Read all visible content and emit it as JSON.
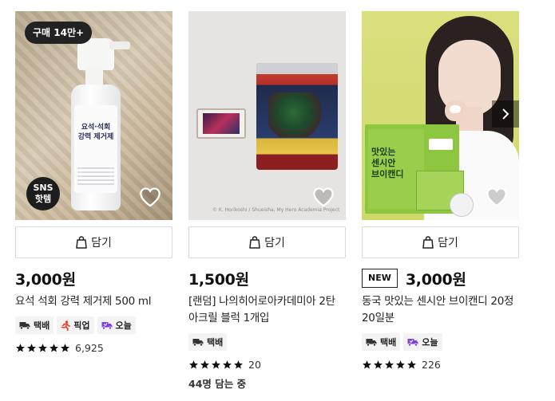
{
  "products": [
    {
      "image_badge": "구매 14만+",
      "sns_badge": "SNS\n핫템",
      "label_text": "요석·석회\n강력 제거제",
      "cart_label": "담기",
      "new_badge": "",
      "price": "3,000원",
      "name": "요석 석회 강력 제거제 500 ml",
      "tags": [
        {
          "icon": "delivery-truck-icon",
          "label": "택배",
          "color": "#333333"
        },
        {
          "icon": "pickup-runner-icon",
          "label": "픽업",
          "color": "#e8412c"
        },
        {
          "icon": "today-delivery-icon",
          "label": "오늘",
          "color": "#7b3fe4"
        }
      ],
      "rating_stars": 5,
      "review_count": "6,925",
      "meta": ""
    },
    {
      "image_badge": "",
      "sns_badge": "",
      "copyright": "© K. Horikoshi / Shueisha, My Hero Academia Project",
      "cart_label": "담기",
      "new_badge": "",
      "price": "1,500원",
      "name": "[랜덤] 나의히어로아카데미아 2탄 아크릴 블럭 1개입",
      "tags": [
        {
          "icon": "delivery-truck-icon",
          "label": "택배",
          "color": "#333333"
        }
      ],
      "rating_stars": 5,
      "review_count": "20",
      "meta": "44명 담는 중"
    },
    {
      "image_badge": "",
      "sns_badge": "",
      "box_text": "맛있는\n센시안\n브이캔디",
      "cart_label": "담기",
      "new_badge": "NEW",
      "price": "3,000원",
      "name": "동국 맛있는 센시안 브이캔디 20정 20일분",
      "tags": [
        {
          "icon": "delivery-truck-icon",
          "label": "택배",
          "color": "#333333"
        },
        {
          "icon": "today-delivery-icon",
          "label": "오늘",
          "color": "#7b3fe4"
        }
      ],
      "rating_stars": 5,
      "review_count": "226",
      "meta": ""
    }
  ],
  "colors": {
    "star": "#111111",
    "heart": "#ffffff",
    "tag_bg": "#f3f3f3"
  }
}
